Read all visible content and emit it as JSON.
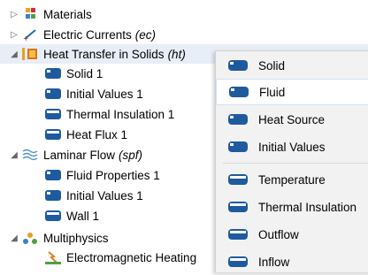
{
  "tree": [
    {
      "label": "Materials",
      "tag": "",
      "expanded": false,
      "icon": "materials-icon"
    },
    {
      "label": "Electric Currents",
      "tag": "(ec)",
      "expanded": false,
      "icon": "electric-currents-icon"
    },
    {
      "label": "Heat Transfer in Solids",
      "tag": "(ht)",
      "expanded": true,
      "icon": "heat-transfer-icon"
    },
    {
      "label": "Solid 1",
      "tag": "",
      "icon": "domain-node-icon"
    },
    {
      "label": "Initial Values 1",
      "tag": "",
      "icon": "domain-node-icon"
    },
    {
      "label": "Thermal Insulation 1",
      "tag": "",
      "icon": "boundary-node-icon"
    },
    {
      "label": "Heat Flux 1",
      "tag": "",
      "icon": "boundary-node-icon"
    },
    {
      "label": "Laminar Flow",
      "tag": "(spf)",
      "expanded": true,
      "icon": "laminar-flow-icon"
    },
    {
      "label": "Fluid Properties 1",
      "tag": "",
      "icon": "domain-node-icon"
    },
    {
      "label": "Initial Values 1",
      "tag": "",
      "icon": "domain-node-icon"
    },
    {
      "label": "Wall 1",
      "tag": "",
      "icon": "boundary-node-icon"
    },
    {
      "label": "Multiphysics",
      "tag": "",
      "expanded": true,
      "icon": "multiphysics-icon"
    },
    {
      "label": "Electromagnetic Heating",
      "tag": "",
      "icon": "electromagnetic-heating-icon"
    }
  ],
  "menu": [
    {
      "label": "Solid",
      "icon": "domain-feature-icon",
      "highlighted": false
    },
    {
      "label": "Fluid",
      "icon": "domain-feature-icon",
      "highlighted": true
    },
    {
      "label": "Heat Source",
      "icon": "domain-feature-icon",
      "highlighted": false
    },
    {
      "label": "Initial Values",
      "icon": "domain-feature-icon",
      "highlighted": false
    },
    {
      "label": "Temperature",
      "icon": "boundary-feature-icon",
      "highlighted": false
    },
    {
      "label": "Thermal Insulation",
      "icon": "boundary-feature-icon",
      "highlighted": false
    },
    {
      "label": "Outflow",
      "icon": "boundary-feature-icon",
      "highlighted": false
    },
    {
      "label": "Inflow",
      "icon": "boundary-feature-icon",
      "highlighted": false
    }
  ],
  "colors": {
    "node_blue": "#1f5a9e",
    "selection": "#e7eef8",
    "menu_bg": "#f2f2f2"
  }
}
